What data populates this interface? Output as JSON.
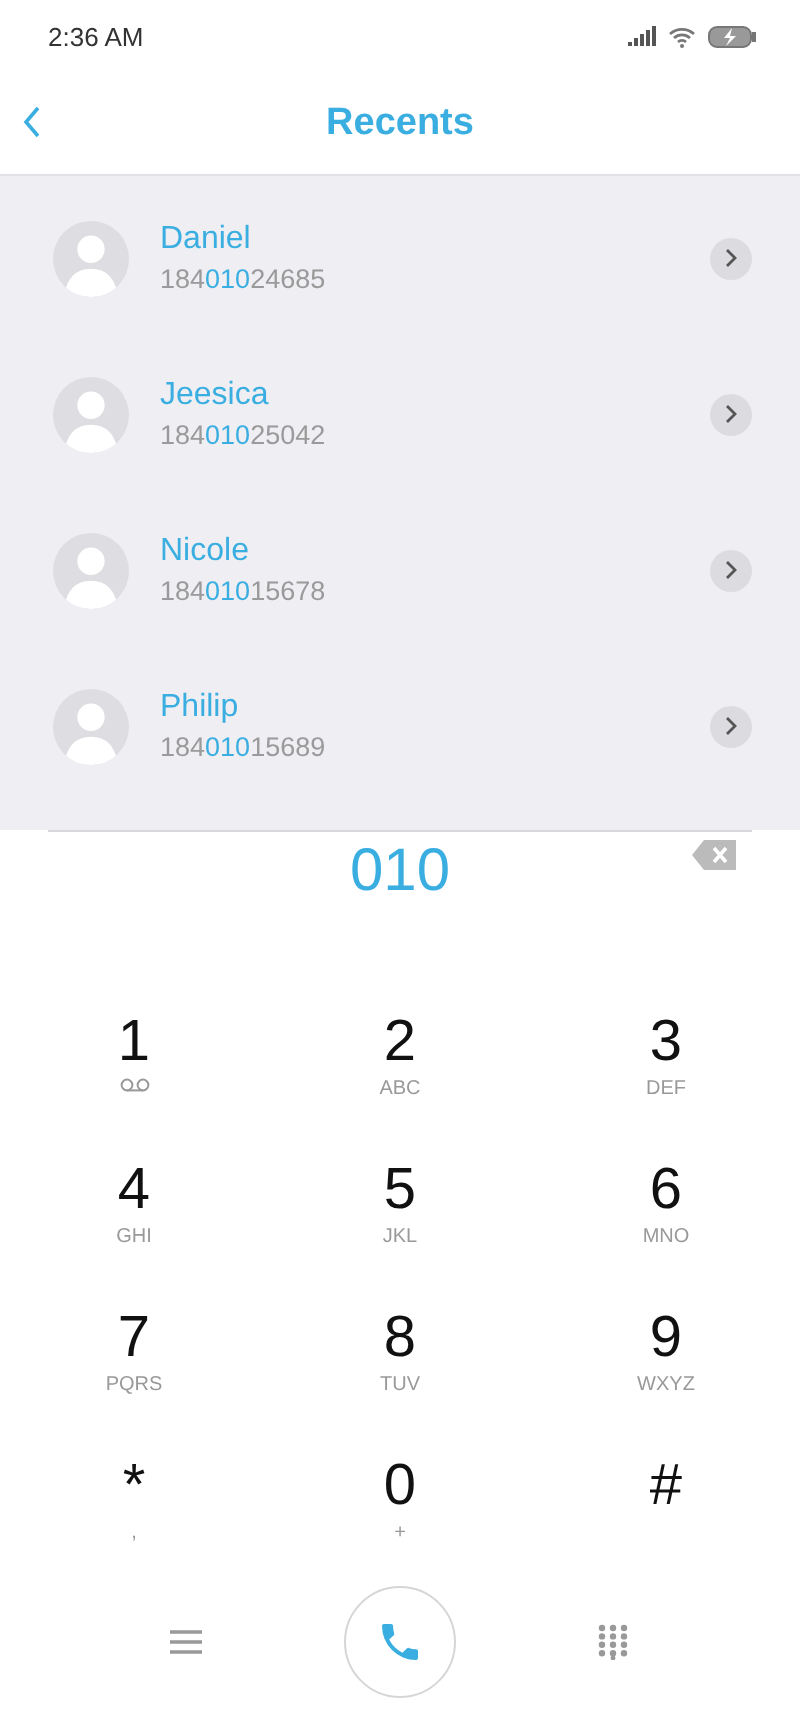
{
  "status_bar": {
    "time": "2:36 AM"
  },
  "header": {
    "title": "Recents"
  },
  "contacts": [
    {
      "name": "Daniel",
      "number": {
        "before": "184",
        "match": "010",
        "after": "24685"
      }
    },
    {
      "name": "Jeesica",
      "number": {
        "before": "184",
        "match": "010",
        "after": "25042"
      }
    },
    {
      "name": "Nicole",
      "number": {
        "before": "184",
        "match": "010",
        "after": "15678"
      }
    },
    {
      "name": "Philip",
      "number": {
        "before": "184",
        "match": "010",
        "after": "15689"
      }
    }
  ],
  "dialed": "010",
  "keys": [
    {
      "digit": "1",
      "kind": "voicemail"
    },
    {
      "digit": "2",
      "letters": "ABC",
      "kind": "letters"
    },
    {
      "digit": "3",
      "letters": "DEF",
      "kind": "letters"
    },
    {
      "digit": "4",
      "letters": "GHI",
      "kind": "letters"
    },
    {
      "digit": "5",
      "letters": "JKL",
      "kind": "letters"
    },
    {
      "digit": "6",
      "letters": "MNO",
      "kind": "letters"
    },
    {
      "digit": "7",
      "letters": "PQRS",
      "kind": "letters"
    },
    {
      "digit": "8",
      "letters": "TUV",
      "kind": "letters"
    },
    {
      "digit": "9",
      "letters": "WXYZ",
      "kind": "letters"
    },
    {
      "digit": "*",
      "letters": ",",
      "kind": "letters"
    },
    {
      "digit": "0",
      "letters": "+",
      "kind": "letters"
    },
    {
      "digit": "#",
      "kind": "plain"
    }
  ]
}
